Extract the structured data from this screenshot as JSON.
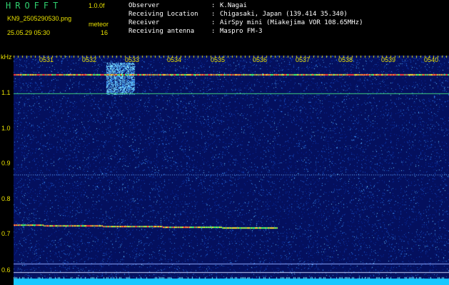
{
  "app": {
    "title": "HROFFT",
    "version": "1.0.0f"
  },
  "file": {
    "name": "KN9_2505290530.png",
    "datetime": "25.05.29 05:30",
    "label": "meteor",
    "count": "16"
  },
  "info": [
    {
      "label": "Observer",
      "value": "K.Nagai"
    },
    {
      "label": "Receiving Location",
      "value": "Chigasaki, Japan (139.414 35.340)"
    },
    {
      "label": "Receiver",
      "value": "AirSpy mini (Miakejima VOR 108.65MHz)"
    },
    {
      "label": "Receiving antenna",
      "value": "Maspro FM-3"
    }
  ],
  "axis": {
    "unit": "kHz",
    "times": [
      "0531",
      "0532",
      "0533",
      "0534",
      "0535",
      "0536",
      "0537",
      "0538",
      "0539",
      "0540"
    ],
    "freqs": [
      "1.1",
      "1.0",
      "0.9",
      "0.8",
      "0.7",
      "0.6"
    ]
  },
  "colors": {
    "label": "#e8e000",
    "title": "#2fcf6f",
    "background": "#04105e",
    "noise": "#2a6fd8",
    "trace": "#ff3a3a"
  }
}
